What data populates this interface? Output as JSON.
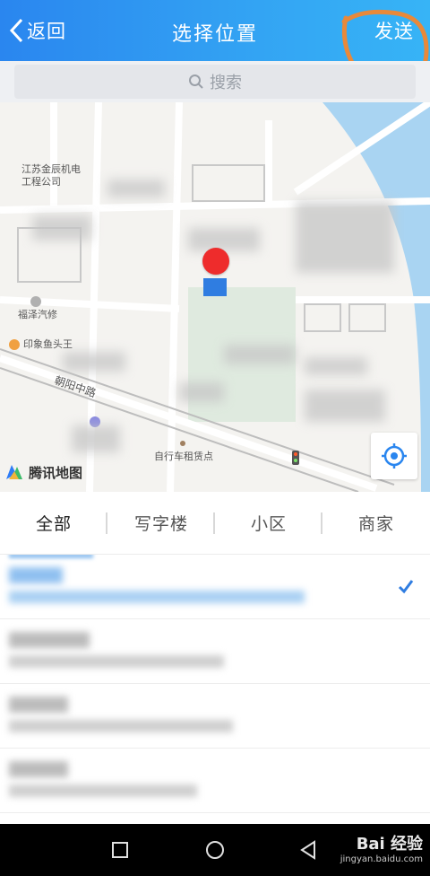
{
  "header": {
    "back_label": "返回",
    "title": "选择位置",
    "send_label": "发送",
    "gradient_start": "#2a86ef",
    "gradient_end": "#37b4f6"
  },
  "search": {
    "placeholder": "搜索",
    "icon": "search-icon"
  },
  "map": {
    "labels": {
      "company": "江苏金辰机电\n工程公司",
      "auto_repair": "福泽汽修",
      "restaurant": "印象鱼头王",
      "road": "朝阳中路",
      "bike_station": "自行车租赁点"
    },
    "logo_text": "腾讯地图",
    "marker_color": "#ee2c2c",
    "locate_icon": "locate-target-icon"
  },
  "tabs": [
    {
      "label": "全部",
      "active": true
    },
    {
      "label": "写字楼",
      "active": false
    },
    {
      "label": "小区",
      "active": false
    },
    {
      "label": "商家",
      "active": false
    }
  ],
  "list": {
    "selected_index": 0,
    "accent_color": "#2f7de1"
  },
  "system_nav": {
    "buttons": [
      "recent-apps-icon",
      "home-icon",
      "back-triangle-icon"
    ]
  },
  "watermark": {
    "main": "Bai 经验",
    "sub": "jingyan.baidu.com"
  }
}
